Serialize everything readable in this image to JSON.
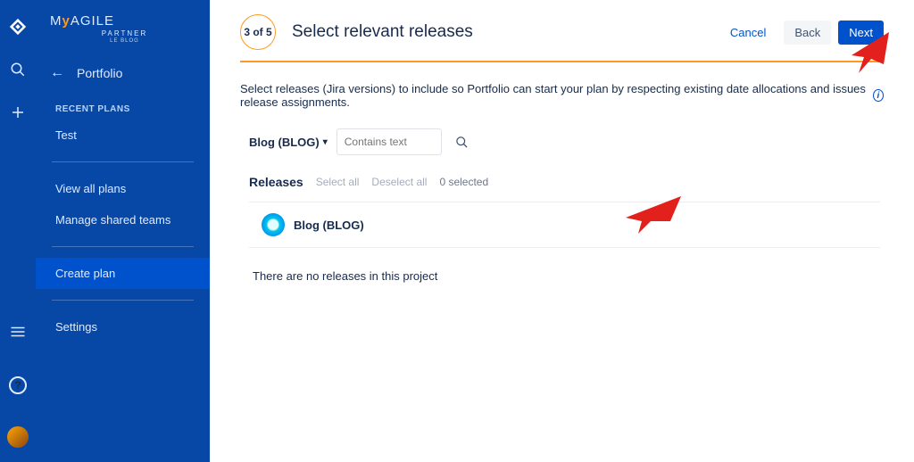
{
  "rail": {
    "product_icon": "jira",
    "search_icon": "search",
    "create_icon": "plus"
  },
  "logo": {
    "line1": "MyAGILE",
    "line2": "PARTNER",
    "tagline": "LE BLOG"
  },
  "sidebar": {
    "back_icon": "←",
    "title": "Portfolio",
    "recent_label": "RECENT PLANS",
    "recent": [
      "Test"
    ],
    "view_all": "View all plans",
    "manage_teams": "Manage shared teams",
    "create_plan": "Create plan",
    "settings": "Settings"
  },
  "wizard": {
    "step": "3 of 5",
    "title": "Select relevant releases"
  },
  "actions": {
    "cancel": "Cancel",
    "back": "Back",
    "next": "Next"
  },
  "description": "Select releases (Jira versions) to include so Portfolio can start your plan by respecting existing date allocations and issues release assignments.",
  "filter": {
    "project_label": "Blog (BLOG)",
    "placeholder": "Contains text"
  },
  "releases": {
    "label": "Releases",
    "select_all": "Select all",
    "deselect_all": "Deselect all",
    "count": "0 selected"
  },
  "project": {
    "name": "Blog (BLOG)"
  },
  "empty": "There are no releases in this project"
}
